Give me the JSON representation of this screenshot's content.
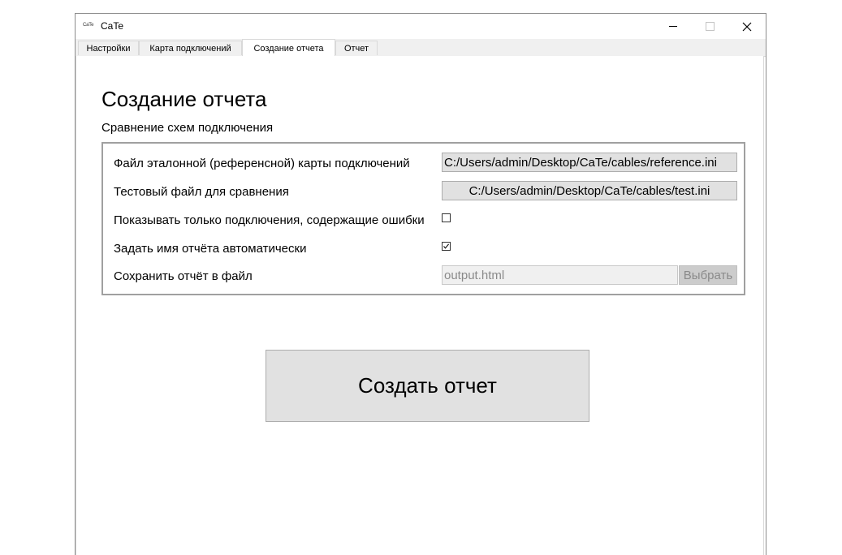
{
  "window": {
    "icon_text": "CaTe",
    "title": "CaTe"
  },
  "tabs": [
    {
      "label": "Настройки",
      "active": false
    },
    {
      "label": "Карта подключений",
      "active": false
    },
    {
      "label": "Создание отчета",
      "active": true
    },
    {
      "label": "Отчет",
      "active": false
    }
  ],
  "page": {
    "title": "Создание отчета",
    "subtitle": "Сравнение схем подключения"
  },
  "form": {
    "reference_label": "Файл эталонной (референсной) карты подключений",
    "reference_path": "C:/Users/admin/Desktop/CaTe/cables/reference.ini",
    "test_label": "Тестовый файл для сравнения",
    "test_path": "C:/Users/admin/Desktop/CaTe/cables/test.ini",
    "errors_only_label": "Показывать только подключения, содержащие ошибки",
    "errors_only_checked": false,
    "auto_name_label": "Задать имя отчёта автоматически",
    "auto_name_checked": true,
    "save_label": "Сохранить отчёт в файл",
    "save_value": "output.html",
    "choose_label": "Выбрать"
  },
  "actions": {
    "create_label": "Создать отчет"
  }
}
